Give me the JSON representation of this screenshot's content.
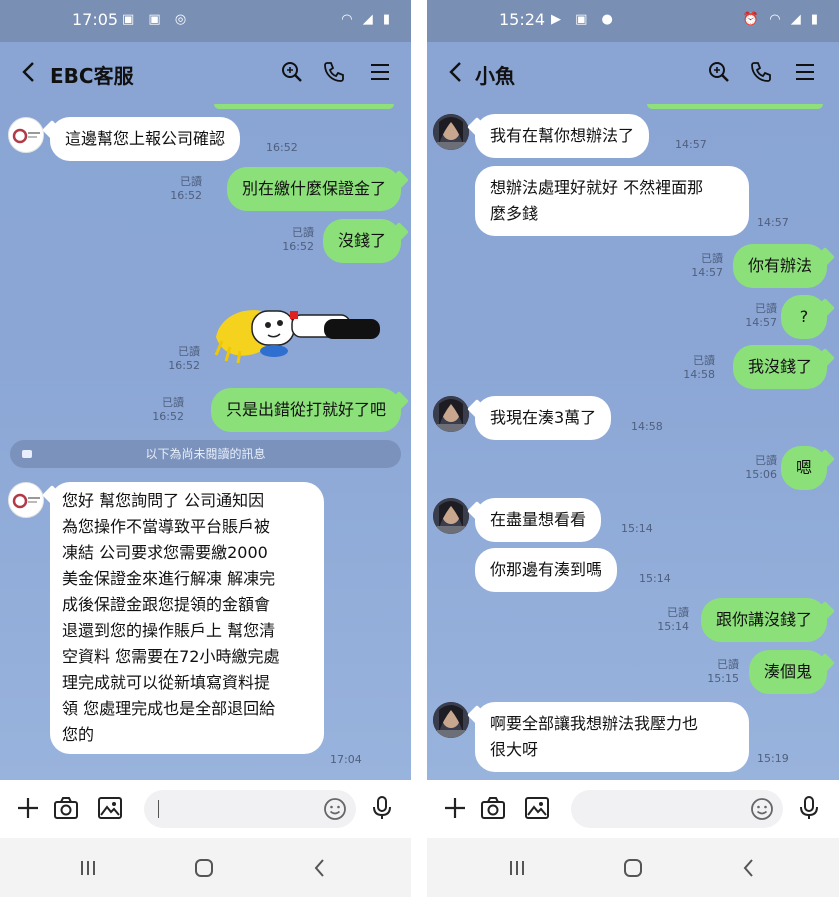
{
  "left": {
    "status_time": "17:05",
    "title": "EBC客服",
    "input_placeholder": "",
    "unread_divider": "以下為尚未閱讀的訊息",
    "messages": [
      {
        "text": "這邊幫您上報公司確認",
        "time": "16:52"
      },
      {
        "text": "別在繳什麼保證金了",
        "read": "已讀",
        "time": "16:52"
      },
      {
        "text": "沒錢了",
        "read": "已讀",
        "time": "16:52"
      },
      {
        "sticker": "sticker-character-lying-down",
        "read": "已讀",
        "time": "16:52"
      },
      {
        "text": "只是出錯從打就好了吧",
        "read": "已讀",
        "time": "16:52"
      },
      {
        "text": "您好 幫您詢問了 公司通知因\n為您操作不當導致平台賬戶被\n凍結 公司要求您需要繳2000\n美金保證金來進行解凍 解凍完\n成後保證金跟您提領的金額會\n退還到您的操作賬戶上 幫您清\n空資料 您需要在72小時繳完處\n理完成就可以從新填寫資料提\n領 您處理完成也是全部退回給\n您的",
        "time": "17:04"
      }
    ]
  },
  "right": {
    "status_time": "15:24",
    "title": "小魚",
    "input_placeholder": "",
    "messages": [
      {
        "text": "我有在幫你想辦法了",
        "time": "14:57"
      },
      {
        "text": "想辦法處理好就好 不然裡面那\n麼多錢",
        "time": "14:57"
      },
      {
        "text": "你有辦法",
        "read": "已讀",
        "time": "14:57"
      },
      {
        "text": "?",
        "read": "已讀",
        "time": "14:57"
      },
      {
        "text": "我沒錢了",
        "read": "已讀",
        "time": "14:58"
      },
      {
        "text": "我現在湊3萬了",
        "time": "14:58"
      },
      {
        "text": "嗯",
        "read": "已讀",
        "time": "15:06"
      },
      {
        "text": "在盡量想看看",
        "time": "15:14"
      },
      {
        "text": "你那邊有湊到嗎",
        "time": "15:14"
      },
      {
        "text": "跟你講沒錢了",
        "read": "已讀",
        "time": "15:14"
      },
      {
        "text": "湊個鬼",
        "read": "已讀",
        "time": "15:15"
      },
      {
        "text": "啊要全部讓我想辦法我壓力也\n很大呀",
        "time": "15:19"
      }
    ]
  },
  "icons": [
    "back-icon",
    "search-icon",
    "phone-icon",
    "menu-icon",
    "plus-icon",
    "camera-icon",
    "image-icon",
    "emoji-icon",
    "mic-icon",
    "recents-icon",
    "home-icon",
    "nav-back-icon"
  ],
  "colors": {
    "chat_bg": "#8ba6d5",
    "outgoing_bubble": "#8ce07a",
    "incoming_bubble": "#ffffff",
    "status_bar": "#7a8fb4"
  }
}
